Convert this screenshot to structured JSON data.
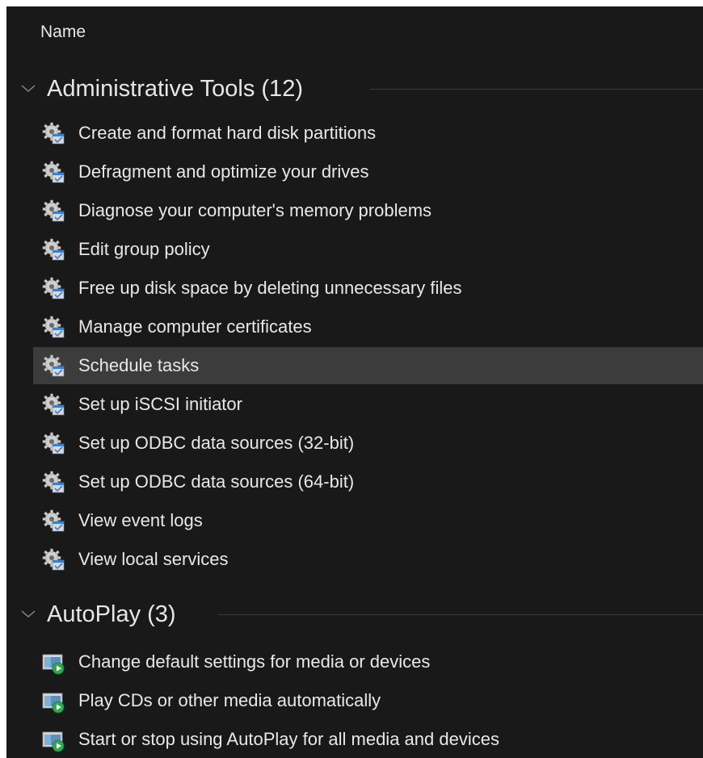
{
  "column_header": "Name",
  "groups": [
    {
      "title": "Administrative Tools (12)",
      "items": [
        {
          "label": "Create and format hard disk partitions"
        },
        {
          "label": "Defragment and optimize your drives"
        },
        {
          "label": "Diagnose your computer's memory problems"
        },
        {
          "label": "Edit group policy"
        },
        {
          "label": "Free up disk space by deleting unnecessary files"
        },
        {
          "label": "Manage computer certificates"
        },
        {
          "label": "Schedule tasks",
          "selected": true
        },
        {
          "label": "Set up iSCSI initiator"
        },
        {
          "label": "Set up ODBC data sources (32-bit)"
        },
        {
          "label": "Set up ODBC data sources (64-bit)"
        },
        {
          "label": "View event logs"
        },
        {
          "label": "View local services"
        }
      ]
    },
    {
      "title": "AutoPlay (3)",
      "items": [
        {
          "label": "Change default settings for media or devices"
        },
        {
          "label": "Play CDs or other media automatically"
        },
        {
          "label": "Start or stop using AutoPlay for all media and devices"
        }
      ]
    }
  ],
  "icons": {
    "group_chevron": "chevron-down-icon",
    "administrative_tools_item": "admin-tools-gear-icon",
    "autoplay_item": "autoplay-icon"
  },
  "colors": {
    "background": "#191919",
    "selected_row": "#3c3c3c",
    "text": "#e8e8e8"
  }
}
